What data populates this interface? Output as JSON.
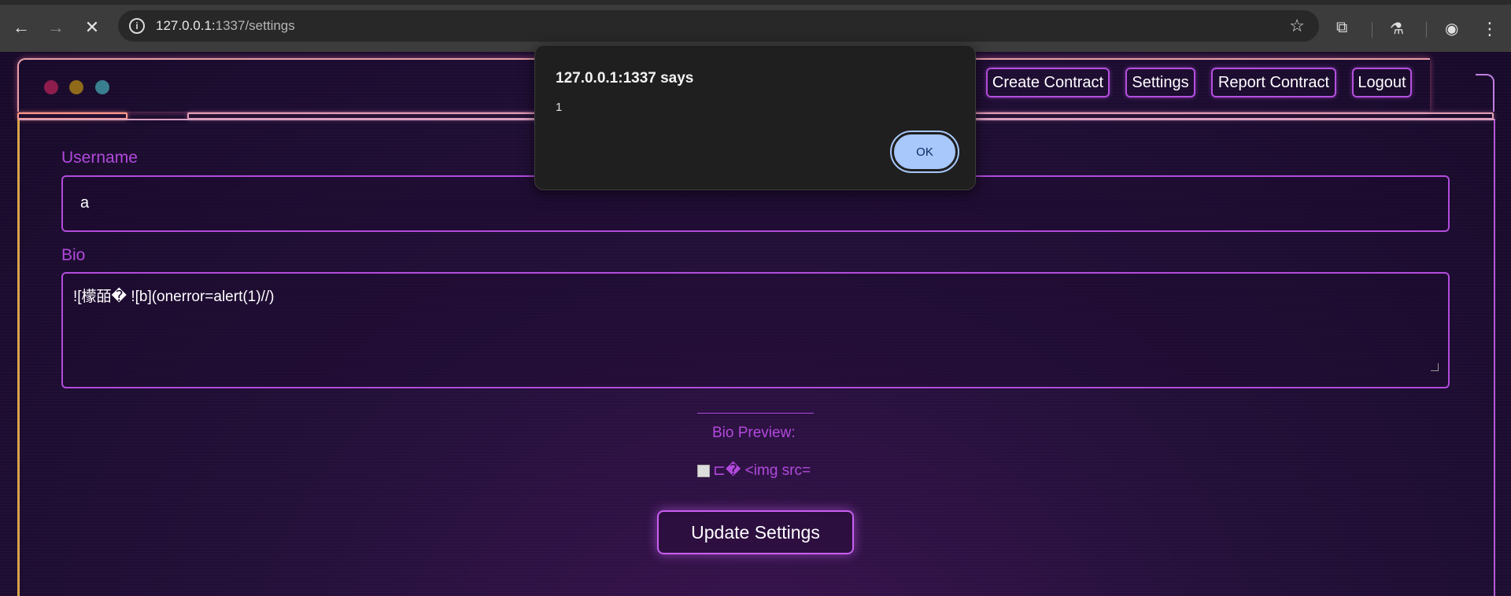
{
  "browser": {
    "url_host": "127.0.0.1:",
    "url_port_path": "1337/settings",
    "back_icon": "←",
    "forward_icon": "→",
    "stop_icon": "✕",
    "star_icon": "☆",
    "extension_icon": "⧉",
    "labs_icon": "⚗",
    "profile_icon": "◉",
    "menu_icon": "⋮",
    "info_icon": "i"
  },
  "nav": {
    "create_contract": "Create Contract",
    "settings": "Settings",
    "report_contract": "Report Contract",
    "logout": "Logout"
  },
  "form": {
    "username_label": "Username",
    "username_value": "a",
    "bio_label": "Bio",
    "bio_value": "![檬皕� ![b](onerror=alert(1)//)",
    "preview_label": "Bio Preview:",
    "preview_text": "⊏� <img src=",
    "submit_label": "Update Settings"
  },
  "dialog": {
    "title": "127.0.0.1:1337 says",
    "message": "1",
    "ok_label": "OK"
  },
  "colors": {
    "accent": "#b249dc",
    "dialog_button": "#a8c7fa"
  }
}
